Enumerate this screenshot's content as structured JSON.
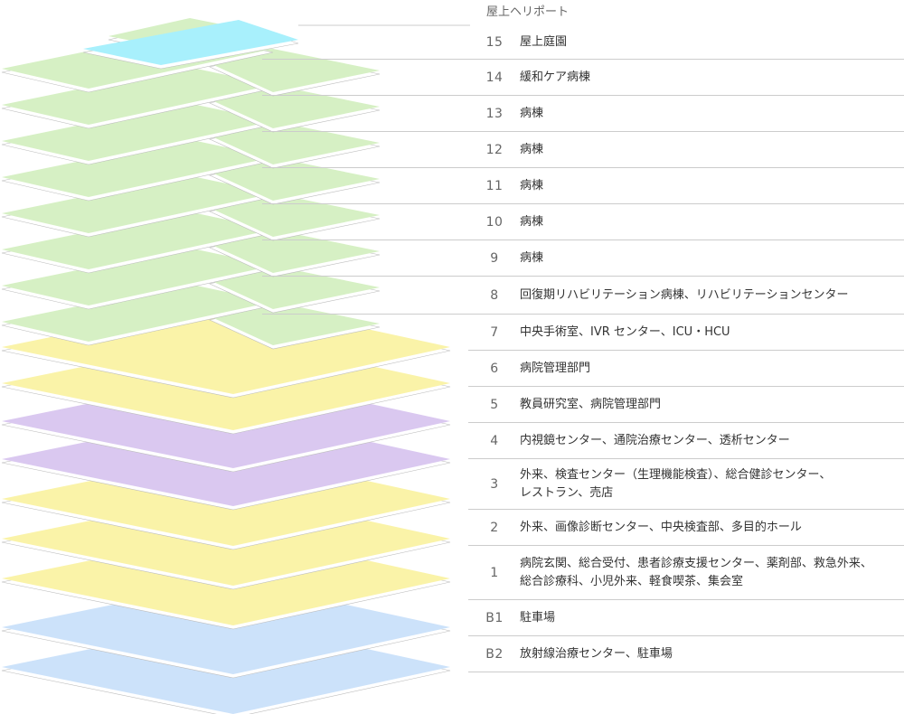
{
  "roof_label": "屋上ヘリポート",
  "floors": [
    {
      "num": "15",
      "label": "屋上庭園",
      "color": "#d6f0c4"
    },
    {
      "num": "14",
      "label": "緩和ケア病棟",
      "color": "#d6f0c4"
    },
    {
      "num": "13",
      "label": "病棟",
      "color": "#d6f0c4"
    },
    {
      "num": "12",
      "label": "病棟",
      "color": "#d6f0c4"
    },
    {
      "num": "11",
      "label": "病棟",
      "color": "#d6f0c4"
    },
    {
      "num": "10",
      "label": "病棟",
      "color": "#d6f0c4"
    },
    {
      "num": "9",
      "label": "病棟",
      "color": "#d6f0c4"
    },
    {
      "num": "8",
      "label": "回復期リハビリテーション病棟、リハビリテーションセンター",
      "color": "#d6f0c4"
    },
    {
      "num": "7",
      "label": "中央手術室、IVR センター、ICU・HCU",
      "color": "#faf3a8"
    },
    {
      "num": "6",
      "label": "病院管理部門",
      "color": "#faf3a8"
    },
    {
      "num": "5",
      "label": "教員研究室、病院管理部門",
      "color": "#dac8f0"
    },
    {
      "num": "4",
      "label": "内視鏡センター、通院治療センター、透析センター",
      "color": "#dac8f0"
    },
    {
      "num": "3",
      "label": "外来、検査センター（生理機能検査）、総合健診センター、\nレストラン、売店",
      "color": "#faf3a8"
    },
    {
      "num": "2",
      "label": "外来、画像診断センター、中央検査部、多目的ホール",
      "color": "#faf3a8"
    },
    {
      "num": "1",
      "label": "病院玄関、総合受付、患者診療支援センター、薬剤部、救急外来、\n総合診療科、小児外来、軽食喫茶、集会室",
      "color": "#faf3a8"
    },
    {
      "num": "B1",
      "label": "駐車場",
      "color": "#cce2fa"
    },
    {
      "num": "B2",
      "label": "放射線治療センター、駐車場",
      "color": "#cce2fa"
    }
  ],
  "colors": {
    "ward_green": "#d6f0c4",
    "yellow": "#faf3a8",
    "purple": "#dac8f0",
    "basement_blue": "#cce2fa",
    "heliport_cyan": "#a8f0fc",
    "divider": "#cccccc"
  }
}
